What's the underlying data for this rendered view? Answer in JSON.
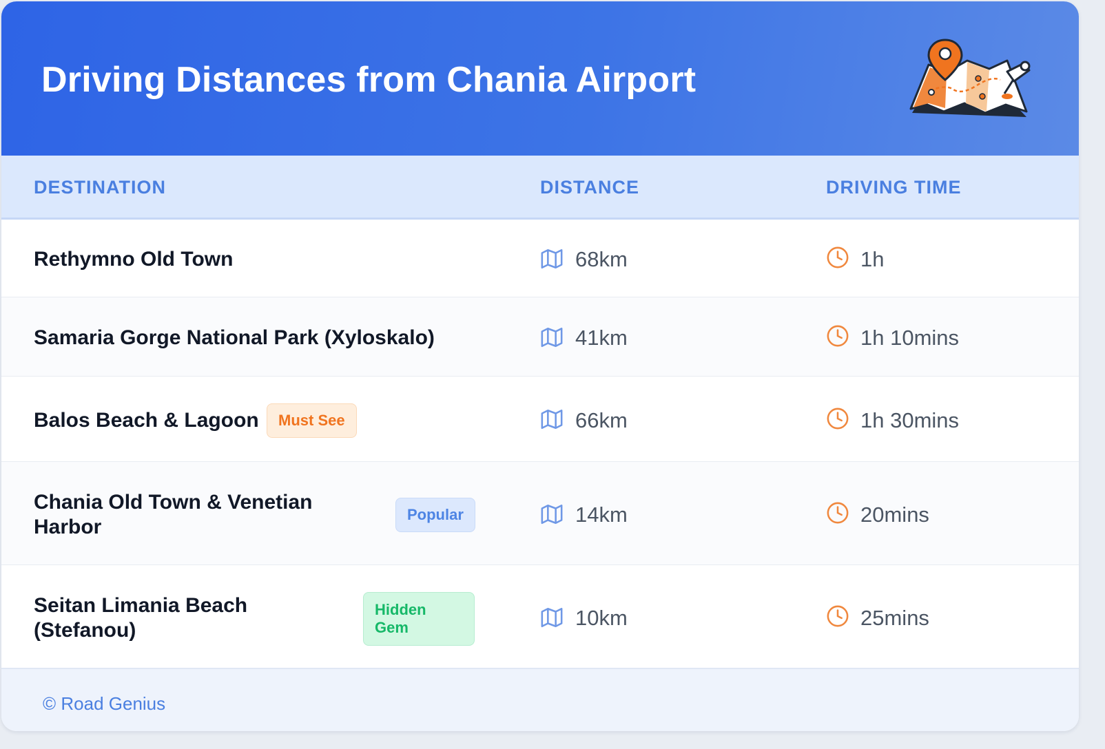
{
  "header": {
    "title": "Driving Distances from Chania Airport",
    "illustration": "map-with-pins-illustration"
  },
  "table": {
    "columns": [
      "DESTINATION",
      "DISTANCE",
      "DRIVING TIME"
    ],
    "rows": [
      {
        "destination": "Rethymno Old Town",
        "distance": "68km",
        "time": "1h"
      },
      {
        "destination": "Samaria Gorge National Park (Xyloskalo)",
        "distance": "41km",
        "time": "1h 10mins"
      },
      {
        "destination": "Balos Beach & Lagoon",
        "badge": "Must See",
        "badge_color": "#f0741f",
        "distance": "66km",
        "time": "1h 30mins"
      },
      {
        "destination": "Chania Old Town & Venetian Harbor",
        "badge": "Popular",
        "badge_color": "#4d84e4",
        "distance": "14km",
        "time": "20mins"
      },
      {
        "destination": "Seitan Limania Beach (Stefanou)",
        "badge": "Hidden Gem",
        "badge_color": "#16b868",
        "distance": "10km",
        "time": "25mins"
      }
    ],
    "distance_icon": "map-icon",
    "time_icon": "clock-icon"
  },
  "footer": {
    "credit": "© Road Genius"
  },
  "colors": {
    "banner": "#2e64e6",
    "header_text": "#4a7fe0",
    "icon_distance": "#6f98e6",
    "icon_time": "#f0883e"
  }
}
